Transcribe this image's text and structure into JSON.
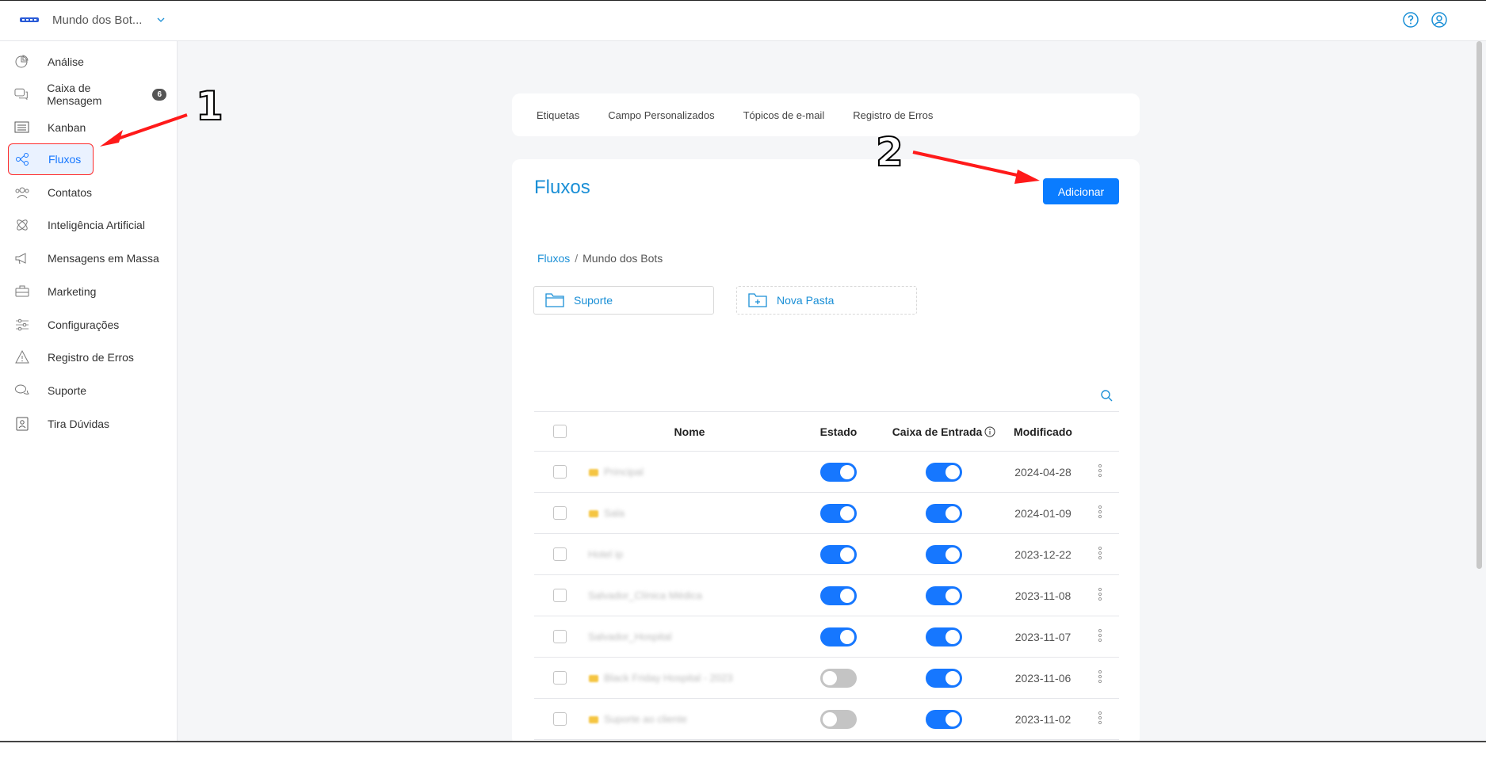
{
  "header": {
    "workspace_name": "Mundo dos Bot...",
    "icons": [
      "help-icon",
      "user-icon"
    ]
  },
  "sidebar": {
    "items": [
      {
        "label": "Análise",
        "icon": "analytics-icon"
      },
      {
        "label": "Caixa de Mensagem",
        "icon": "chat-icon",
        "badge": "6"
      },
      {
        "label": "Kanban",
        "icon": "kanban-icon"
      },
      {
        "label": "Fluxos",
        "icon": "flows-icon",
        "active": true
      },
      {
        "label": "Contatos",
        "icon": "contacts-icon"
      },
      {
        "label": "Inteligência Artificial",
        "icon": "ai-icon"
      },
      {
        "label": "Mensagens em Massa",
        "icon": "megaphone-icon"
      },
      {
        "label": "Marketing",
        "icon": "marketing-icon"
      },
      {
        "label": "Configurações",
        "icon": "settings-icon"
      },
      {
        "label": "Registro de Erros",
        "icon": "warning-icon"
      },
      {
        "label": "Suporte",
        "icon": "support-icon"
      },
      {
        "label": "Tira Dúvidas",
        "icon": "faq-icon"
      }
    ]
  },
  "tabs": [
    {
      "label": "Etiquetas"
    },
    {
      "label": "Campo Personalizados"
    },
    {
      "label": "Tópicos de e-mail"
    },
    {
      "label": "Registro de Erros"
    }
  ],
  "main": {
    "title": "Fluxos",
    "add_button": "Adicionar",
    "breadcrumb": {
      "root": "Fluxos",
      "separator": "/",
      "current": "Mundo dos Bots"
    },
    "folders": [
      {
        "label": "Suporte",
        "icon": "folder-icon"
      },
      {
        "label": "Nova Pasta",
        "icon": "folder-plus-icon"
      }
    ]
  },
  "table": {
    "headers": {
      "name": "Nome",
      "state": "Estado",
      "inbox": "Caixa de Entrada",
      "modified": "Modificado"
    },
    "rows": [
      {
        "name": "Principal",
        "starred": true,
        "state": true,
        "inbox": true,
        "modified": "2024-04-28"
      },
      {
        "name": "Sala",
        "starred": true,
        "state": true,
        "inbox": true,
        "modified": "2024-01-09"
      },
      {
        "name": "Hotel ip",
        "starred": false,
        "state": true,
        "inbox": true,
        "modified": "2023-12-22"
      },
      {
        "name": "Salvador_Clínica Médica",
        "starred": false,
        "state": true,
        "inbox": true,
        "modified": "2023-11-08"
      },
      {
        "name": "Salvador_Hospital",
        "starred": false,
        "state": true,
        "inbox": true,
        "modified": "2023-11-07"
      },
      {
        "name": "Black Friday Hospital - 2023",
        "starred": true,
        "state": false,
        "inbox": true,
        "modified": "2023-11-06"
      },
      {
        "name": "Suporte ao cliente",
        "starred": true,
        "state": false,
        "inbox": true,
        "modified": "2023-11-02"
      }
    ]
  },
  "annotations": {
    "one": "1",
    "two": "2"
  },
  "colors": {
    "accent": "#1677ff",
    "title": "#1a8fd6",
    "annotation_arrow": "#ff1a1a"
  }
}
